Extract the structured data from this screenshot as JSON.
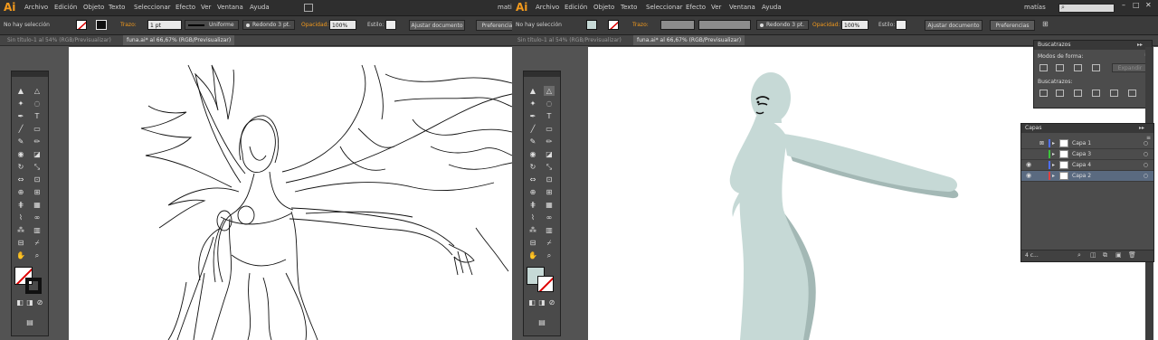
{
  "app_logo": "Ai",
  "left": {
    "menu": [
      "Archivo",
      "Edición",
      "Objeto",
      "Texto",
      "Seleccionar",
      "Efecto",
      "Ver",
      "Ventana",
      "Ayuda"
    ],
    "menu_right": "mati",
    "control": {
      "selection_status": "No hay selección",
      "stroke_label": "Trazo:",
      "stroke_weight": "1 pt",
      "profile": "Uniforme",
      "brush": "Redondo 3 pt.",
      "opacity_label": "Opacidad:",
      "opacity_value": "100%",
      "style_label": "Estilo:",
      "doc_setup_button": "Ajustar documento",
      "prefs_button": "Preferencias"
    },
    "tabs": [
      "Sin título-1 al 54% (RGB/Previsualizar)",
      "funa.ai* al 66,67% (RGB/Previsualizar)"
    ]
  },
  "right": {
    "menu": [
      "Archivo",
      "Edición",
      "Objeto",
      "Texto",
      "Seleccionar",
      "Efecto",
      "Ver",
      "Ventana",
      "Ayuda"
    ],
    "menu_right": "matías",
    "control": {
      "selection_status": "No hay selección",
      "stroke_label": "Trazo:",
      "brush": "Redondo 3 pt.",
      "opacity_label": "Opacidad:",
      "opacity_value": "100%",
      "style_label": "Estilo:",
      "doc_setup_button": "Ajustar documento",
      "prefs_button": "Preferencias"
    },
    "tabs": [
      "Sin título-1 al 54% (RGB/Previsualizar)",
      "funa.ai* al 66,67% (RGB/Previsualizar)"
    ],
    "pathfinder": {
      "title": "Buscatrazos",
      "shape_modes_label": "Modos de forma:",
      "expand_button": "Expandir",
      "pathfinders_label": "Buscatrazos:"
    },
    "layers": {
      "title": "Capas",
      "rows": [
        {
          "name": "Capa 1",
          "color": "#4f6fff",
          "locked": true,
          "visible": false,
          "selected": false
        },
        {
          "name": "Capa 3",
          "color": "#3cc43c",
          "locked": false,
          "visible": false,
          "selected": false
        },
        {
          "name": "Capa 4",
          "color": "#4f6fff",
          "locked": false,
          "visible": true,
          "selected": false
        },
        {
          "name": "Capa 2",
          "color": "#e04040",
          "locked": false,
          "visible": true,
          "selected": true
        }
      ],
      "footer_count": "4 c..."
    }
  },
  "colors": {
    "accent_orange": "#f39a1d",
    "figure_fill": "#c6d9d6",
    "figure_shadow": "#a3b8b5"
  },
  "icons": [
    "selection-tool-icon",
    "direct-selection-tool-icon",
    "pen-tool-icon",
    "type-tool-icon",
    "line-tool-icon",
    "rectangle-tool-icon",
    "paintbrush-tool-icon",
    "pencil-tool-icon",
    "rotate-tool-icon",
    "scale-tool-icon",
    "hand-tool-icon",
    "zoom-tool-icon",
    "fill-swatch-icon",
    "stroke-swatch-icon",
    "search-icon",
    "layer-lock-icon",
    "layer-eye-icon"
  ]
}
